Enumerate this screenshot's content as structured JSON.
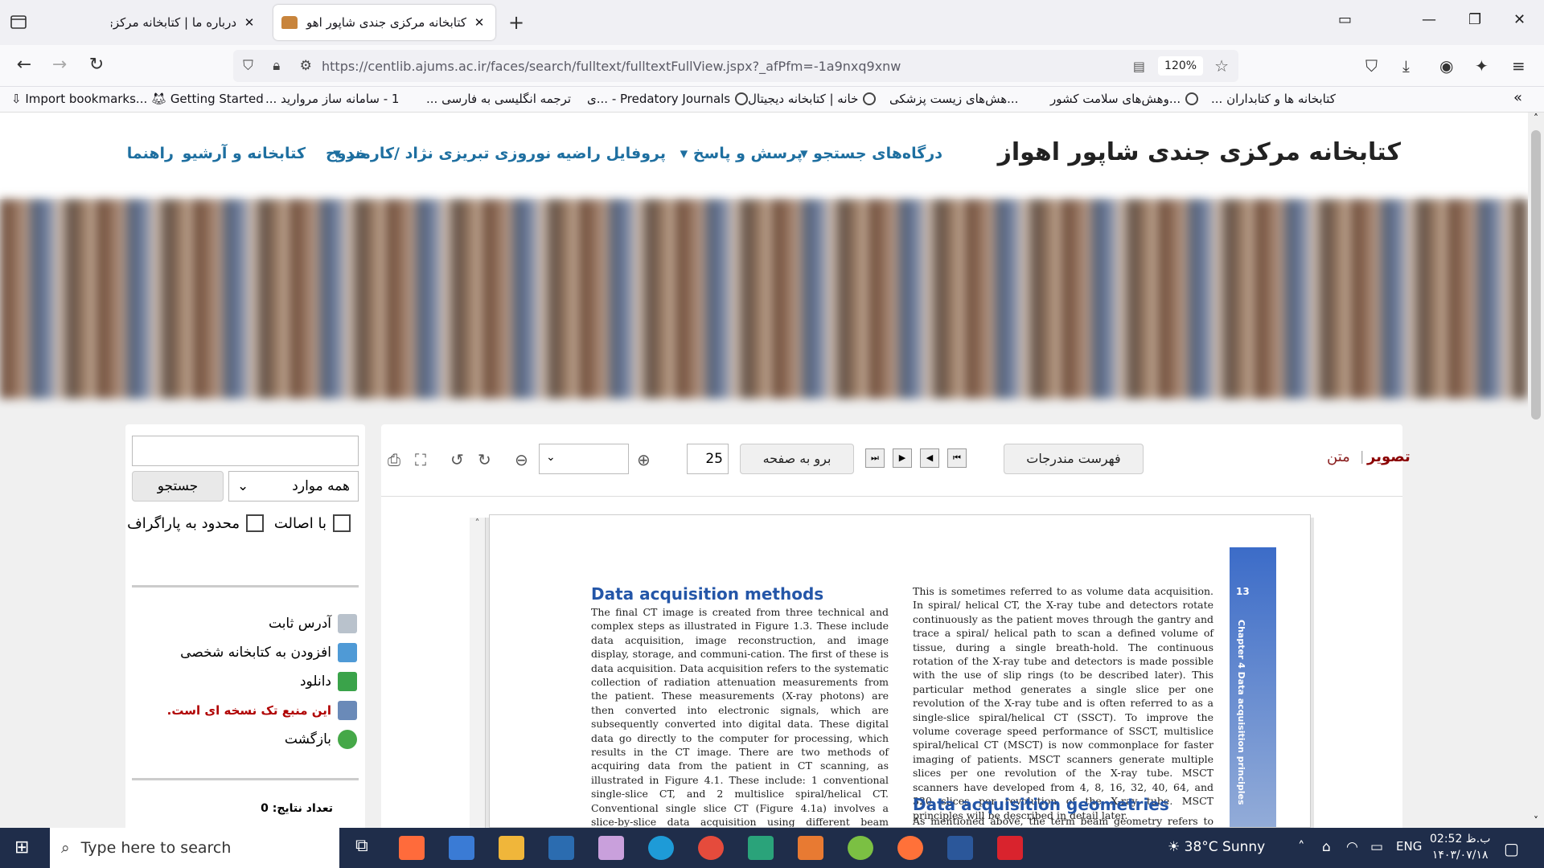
{
  "browser": {
    "tabs": [
      {
        "title": "درباره ما | کتابخانه مرکزی",
        "active": false
      },
      {
        "title": "کتابخانه مرکزی جندی شاپور اهو -",
        "active": true
      }
    ],
    "url": "https://centlib.ajums.ac.ir/faces/search/fulltext/fulltextFullView.jspx?_afPfm=-1a9nxq9xnw",
    "zoom": "120%",
    "bookmarks": [
      "Import bookmarks...",
      "Getting Started",
      "1 - سامانه ساز مروارید ...",
      "ترجمه انگلیسی به فارسی ...",
      "Predatory Journals - ...ی",
      "خانه | کتابخانه دیجیتال",
      "...هش‌های زیست پزشکی",
      "...وهش‌های سلامت کشور",
      "کتابخانه ها و کتابداران ..."
    ]
  },
  "site": {
    "title": "کتابخانه مرکزی جندی شاپور اهواز",
    "menu": [
      "درگاه‌های جستجو",
      "پرسش و پاسخ",
      "پروفایل راضیه نوروزی تبریزی نژاد /کارمند",
      "خروج",
      "کتابخانه و آرشیو",
      "راهنما"
    ]
  },
  "sidebar": {
    "search_placeholder": "",
    "select_value": "همه موارد",
    "search_button": "جستجو",
    "check_authentic": "با اصالت",
    "check_paragraph": "محدود به پاراگراف",
    "actions": [
      "آدرس ثابت",
      "افزودن به کتابخانه شخصی",
      "دانلود",
      "این منبع تک نسخه ای است.",
      "بازگشت"
    ],
    "results_count": "تعداد نتایج: 0"
  },
  "viewer": {
    "tab_image": "تصویر",
    "tab_text": "متن",
    "toc_button": "فهرست مندرجات",
    "goto_button": "برو به صفحه",
    "page_number": "25",
    "zoom_select": ""
  },
  "document": {
    "heading1": "Data acquisition methods",
    "left_col": "The final CT image is created from three technical and complex steps as illustrated in Figure 1.3. These include data acquisition, image reconstruction, and image display, storage, and communi-cation. The first of these is data acquisition. Data acquisition refers to the systematic collection of radiation attenuation measurements from the patient. These measurements (X-ray photons) are then converted into electronic signals, which are subsequently converted into digital data. These digital data go directly to the computer for processing, which results in the CT image. There are two methods of acquiring data from the patient in CT scanning, as illustrated in Figure 4.1. These include: 1 conventional single-slice CT, and 2 multislice spiral/helical CT. Conventional single slice CT (Figure 4.1a) involves a slice-by-slice data acquisition using different beam geometries (size, shape, and motion of the beam and its path) to scan the patient.",
    "right_col": "This is sometimes referred to as volume data acquisition. In spiral/ helical CT, the X-ray tube and detectors rotate continuously as the patient moves through the gantry and trace a spiral/ helical path to scan a defined volume of tissue, during a single breath-hold. The continuous rotation of the X-ray tube and detectors is made possible with the use of slip rings (to be described later). This particular method generates a single slice per one revolution of the X-ray tube and is often referred to as a single-slice spiral/helical CT (SSCT). To improve the volume coverage speed performance of SSCT, multislice spiral/helical CT (MSCT) is now commonplace for faster imaging of patients. MSCT scanners generate multiple slices per one revolution of the X-ray tube. MSCT scanners have developed from 4, 8, 16, 32, 40, 64, and 320 slices per revolution of the X-ray tube. MSCT principles will be described in detail later.",
    "heading2": "Data acquisition geometries",
    "right_col_tail": "As mentioned above, the term beam geometry refers to the size,",
    "page_num": "13",
    "chapter": "Chapter 4 Data acquisition principles"
  },
  "taskbar": {
    "search_placeholder": "Type here to search",
    "weather": "38°C  Sunny",
    "lang": "ENG",
    "time": "02:52 ب.ظ",
    "date": "۱۴۰۳/۰۷/۱۸"
  }
}
